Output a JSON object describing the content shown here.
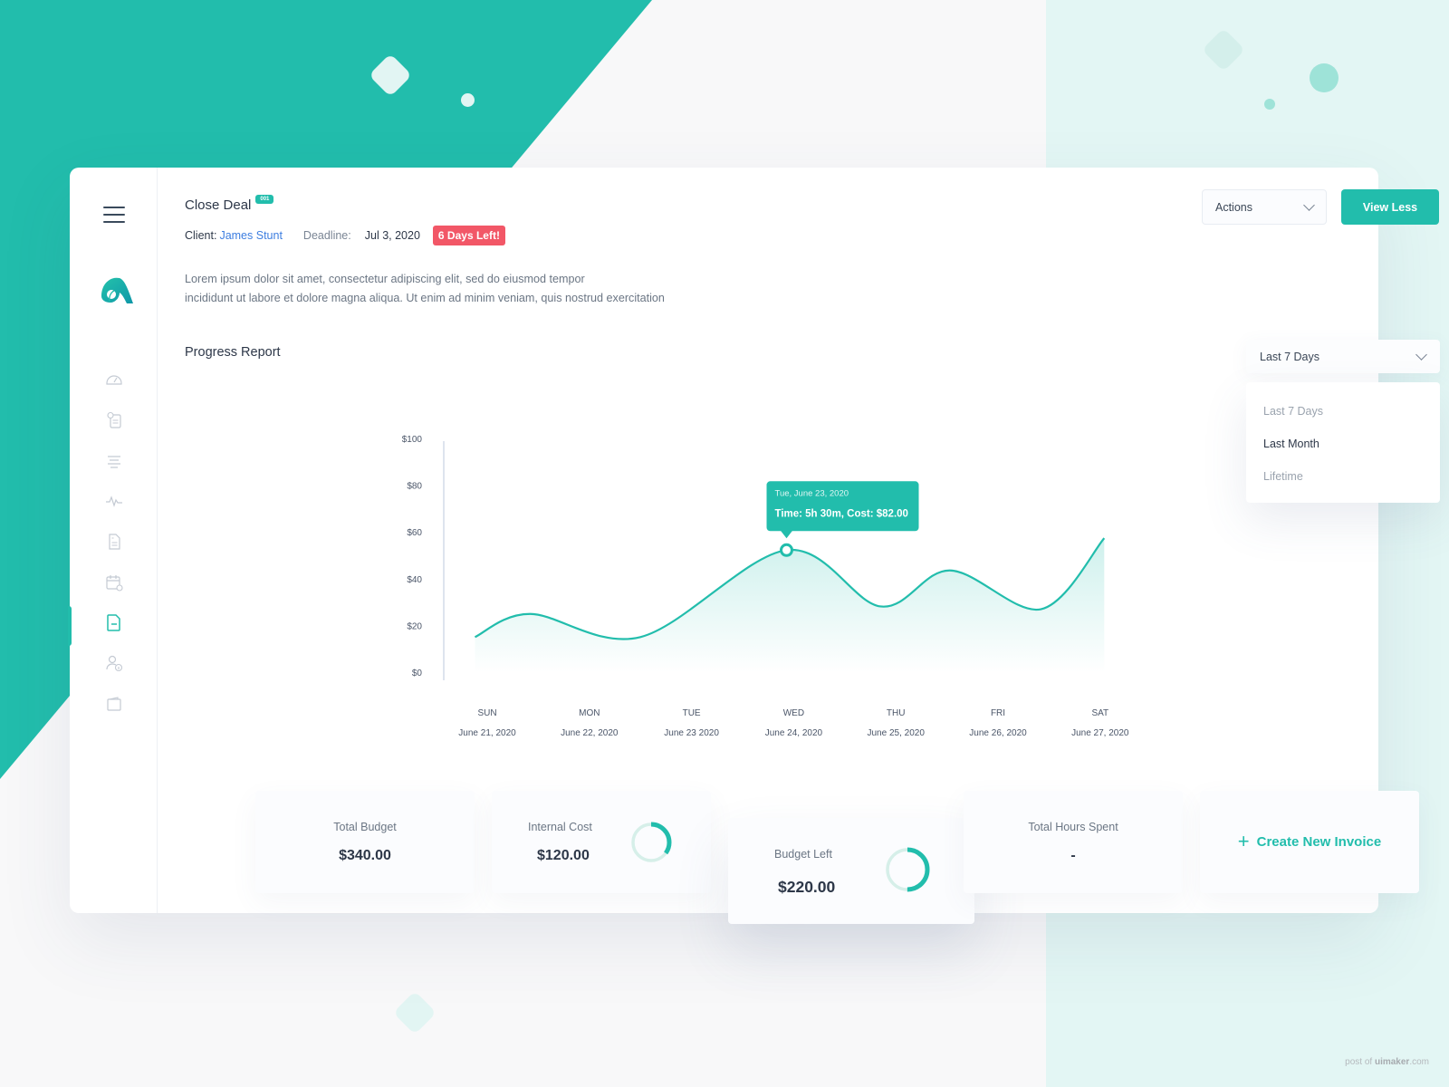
{
  "brand": {
    "accent": "#22bdac",
    "danger": "#f25767",
    "link": "#3d7ee0"
  },
  "sidebar": {
    "menu_icon": "hamburger-icon",
    "logo": "app-logo",
    "items": [
      {
        "icon": "speedometer-icon",
        "active": false
      },
      {
        "icon": "clipboard-clock-icon",
        "active": false
      },
      {
        "icon": "align-center-icon",
        "active": false
      },
      {
        "icon": "activity-pulse-icon",
        "active": false
      },
      {
        "icon": "document-icon",
        "active": false
      },
      {
        "icon": "calendar-check-icon",
        "active": false
      },
      {
        "icon": "file-icon",
        "active": true
      },
      {
        "icon": "user-info-icon",
        "active": false
      },
      {
        "icon": "wallet-icon",
        "active": false
      }
    ]
  },
  "header": {
    "title": "Close Deal",
    "badge": "001",
    "client_label": "Client:",
    "client_name": "James Stunt",
    "deadline_label": "Deadline:",
    "deadline": "Jul 3, 2020",
    "days_left": "6 Days Left!",
    "description_line1": "Lorem ipsum dolor sit amet, consectetur adipiscing elit, sed do eiusmod tempor",
    "description_line2": "incididunt ut labore et dolore magna aliqua. Ut enim ad minim veniam, quis nostrud exercitation"
  },
  "toolbar": {
    "actions_label": "Actions",
    "view_less_label": "View Less"
  },
  "report": {
    "title": "Progress Report",
    "range_selected": "Last 7 Days",
    "range_options": [
      "Last 7 Days",
      "Last Month",
      "Lifetime"
    ],
    "range_highlighted": "Last Month"
  },
  "chart_data": {
    "type": "area",
    "title": "Progress Report",
    "xlabel": "",
    "ylabel": "",
    "ylim": [
      0,
      100
    ],
    "yticks": [
      "$0",
      "$20",
      "$40",
      "$60",
      "$80",
      "$100"
    ],
    "ytick_values": [
      0,
      20,
      40,
      60,
      80,
      100
    ],
    "categories": [
      "SUN",
      "MON",
      "TUE",
      "WED",
      "THU",
      "FRI",
      "SAT"
    ],
    "category_dates": [
      "June 21, 2020",
      "June 22, 2020",
      "June 23 2020",
      "June 24, 2020",
      "June 25, 2020",
      "June 26, 2020",
      "June 27, 2020"
    ],
    "series": [
      {
        "name": "Cost",
        "x": [
          -0.12,
          0.42,
          1.5,
          2.93,
          3.85,
          4.53,
          5.42,
          6.04
        ],
        "values": [
          15.4,
          25.3,
          15.4,
          52.6,
          28.5,
          43.9,
          27.3,
          57.7
        ]
      }
    ],
    "grid": false,
    "tooltip": {
      "x": 2.93,
      "value": 52.6,
      "date": "Tue, June 23, 2020",
      "text": "Time: 5h 30m, Cost: $82.00"
    }
  },
  "stats": [
    {
      "label": "Total Budget",
      "value": "$340.00"
    },
    {
      "label": "Internal Cost",
      "value": "$120.00",
      "ring_fraction": 0.35
    },
    {
      "label": "Budget Left",
      "value": "$220.00",
      "ring_fraction": 0.5
    },
    {
      "label": "Total Hours Spent",
      "value": "-"
    }
  ],
  "create_invoice": {
    "icon": "plus-icon",
    "label": "Create New Invoice"
  },
  "watermark": {
    "prefix": "post of ",
    "brand": "uimaker",
    "suffix": ".com"
  }
}
